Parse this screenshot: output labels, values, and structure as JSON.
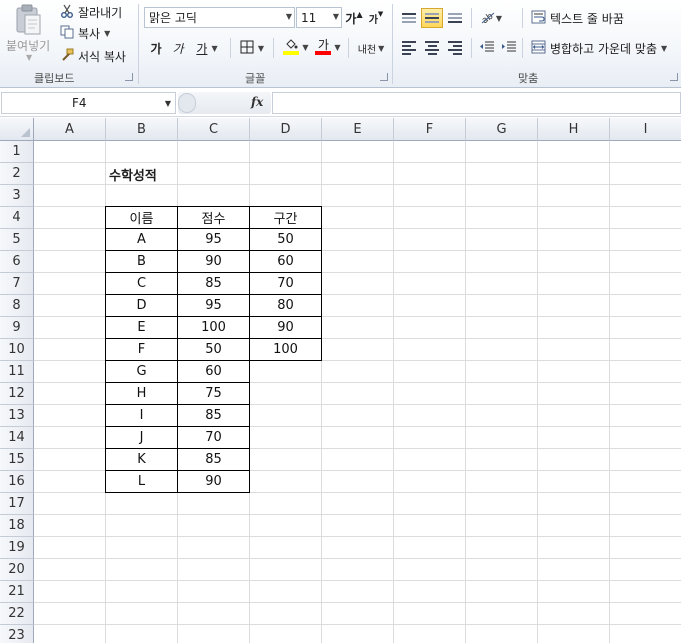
{
  "ribbon": {
    "clipboard": {
      "paste_label": "붙여넣기",
      "cut_label": "잘라내기",
      "copy_label": "복사",
      "format_painter_label": "서식 복사",
      "group_label": "클립보드"
    },
    "font": {
      "font_name": "맑은 고딕",
      "font_size": "11",
      "grow_font": "가",
      "shrink_font": "가",
      "bold": "가",
      "italic": "가",
      "underline": "가",
      "fill_color_hex": "#ffff00",
      "font_color_hex": "#ff0000",
      "font_color_glyph": "가",
      "phonetic": "내천",
      "group_label": "글꼴"
    },
    "alignment": {
      "wrap_text_label": "텍스트 줄 바꿈",
      "merge_center_label": "병합하고 가운데 맞춤",
      "group_label": "맞춤"
    }
  },
  "formula_bar": {
    "name_box": "F4",
    "fx_label": "fx",
    "formula": ""
  },
  "sheet": {
    "columns": [
      "A",
      "B",
      "C",
      "D",
      "E",
      "F",
      "G",
      "H",
      "I"
    ],
    "rows": [
      "1",
      "2",
      "3",
      "4",
      "5",
      "6",
      "7",
      "8",
      "9",
      "10",
      "11",
      "12",
      "13",
      "14",
      "15",
      "16",
      "17",
      "18",
      "19",
      "20",
      "21",
      "22",
      "23"
    ],
    "title": "수학성적",
    "headers": [
      "이름",
      "점수",
      "구간"
    ],
    "names": [
      "A",
      "B",
      "C",
      "D",
      "E",
      "F",
      "G",
      "H",
      "I",
      "J",
      "K",
      "L"
    ],
    "scores": [
      "95",
      "90",
      "85",
      "95",
      "100",
      "50",
      "60",
      "75",
      "85",
      "70",
      "85",
      "90"
    ],
    "bins": [
      "50",
      "60",
      "70",
      "80",
      "90",
      "100"
    ]
  }
}
